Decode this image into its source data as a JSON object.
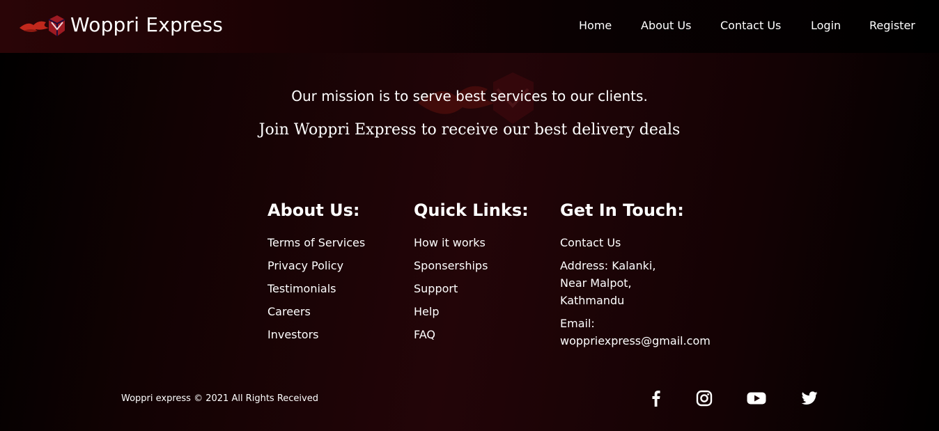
{
  "header": {
    "brand": "Woppri Express",
    "logo_icon": "woppri-flame-logo-icon",
    "nav": [
      "Home",
      "About Us",
      "Contact Us",
      "Login",
      "Register"
    ]
  },
  "hero": {
    "mission": "Our mission is to serve best services to our clients.",
    "join": "Join Woppri Express to receive our best delivery deals"
  },
  "footer": {
    "about": {
      "title": "About Us:",
      "links": [
        "Terms of Services",
        "Privacy Policy",
        "Testimonials",
        "Careers",
        "Investors"
      ]
    },
    "quick_links": {
      "title": "Quick Links:",
      "links": [
        "How it works",
        "Sponserships",
        "Support",
        "Help",
        "FAQ"
      ]
    },
    "contact": {
      "title": "Get In Touch:",
      "contact_link": "Contact Us",
      "address_lines": [
        "Address: Kalanki,",
        "Near Malpot,",
        "Kathmandu"
      ],
      "email_label": "Email:",
      "email": "woppriexpress@gmail.com"
    },
    "copyright": "Woppri express © 2021 All Rights Received",
    "social_icons": [
      "facebook-icon",
      "instagram-icon",
      "youtube-icon",
      "twitter-icon"
    ]
  },
  "colors": {
    "text": "#ffffff",
    "brand_red": "#c0281c",
    "background": "#1a0305"
  }
}
